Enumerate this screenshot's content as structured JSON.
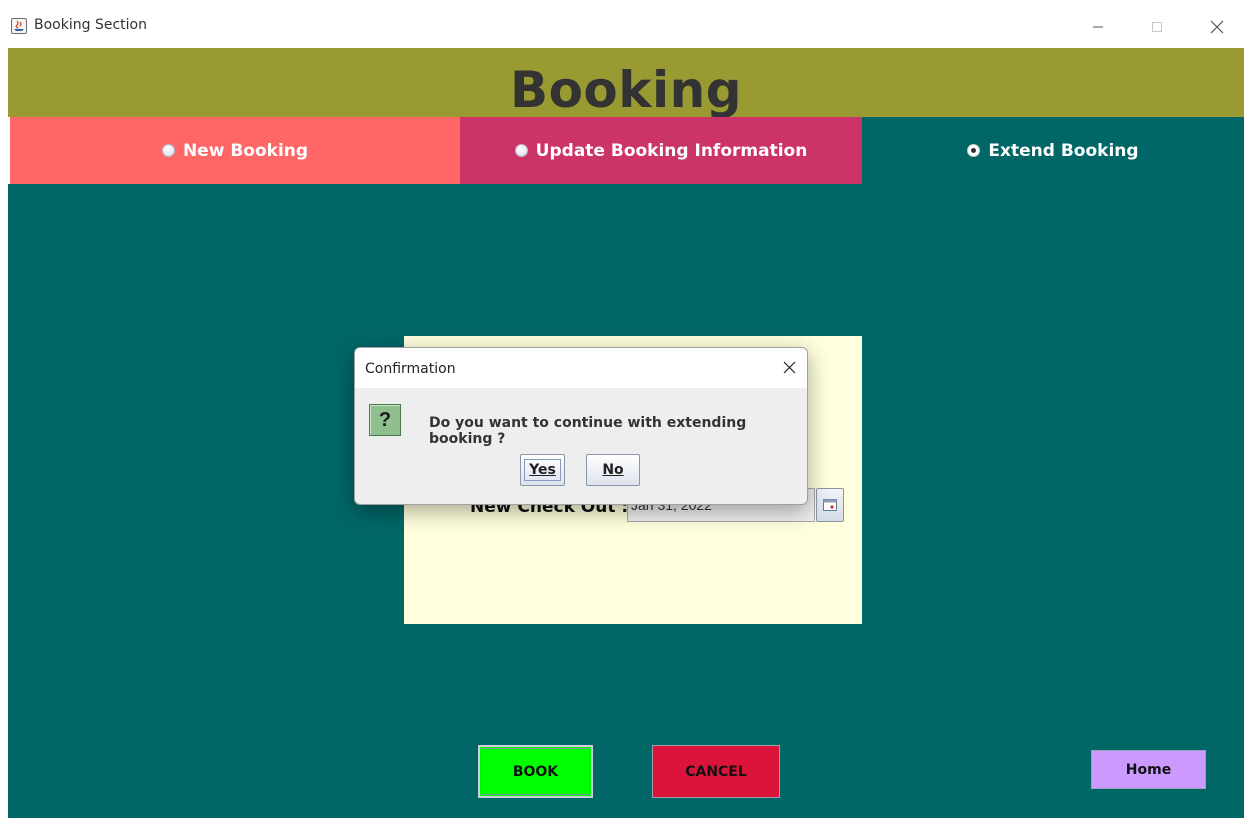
{
  "window": {
    "title": "Booking Section"
  },
  "header": {
    "title": "Booking"
  },
  "tabs": [
    {
      "label": "New Booking",
      "selected": false
    },
    {
      "label": "Update Booking Information",
      "selected": false
    },
    {
      "label": "Extend Booking",
      "selected": true
    }
  ],
  "form": {
    "checkout_label": "New Check Out :",
    "checkout_value": "Jan 31, 2022"
  },
  "dialog": {
    "title": "Confirmation",
    "message": "Do you want to continue with extending booking ?",
    "yes_label": "Yes",
    "no_label": "No"
  },
  "actions": {
    "book_label": "BOOK",
    "cancel_label": "CANCEL",
    "home_label": "Home"
  },
  "colors": {
    "header": "#9a9a33",
    "tab_new": "#ff6666",
    "tab_update": "#cc3366",
    "background": "#006666",
    "form_panel": "#ffffdd",
    "book_button": "#00ff00",
    "cancel_button": "#dc143c",
    "home_button": "#cc99ff"
  }
}
